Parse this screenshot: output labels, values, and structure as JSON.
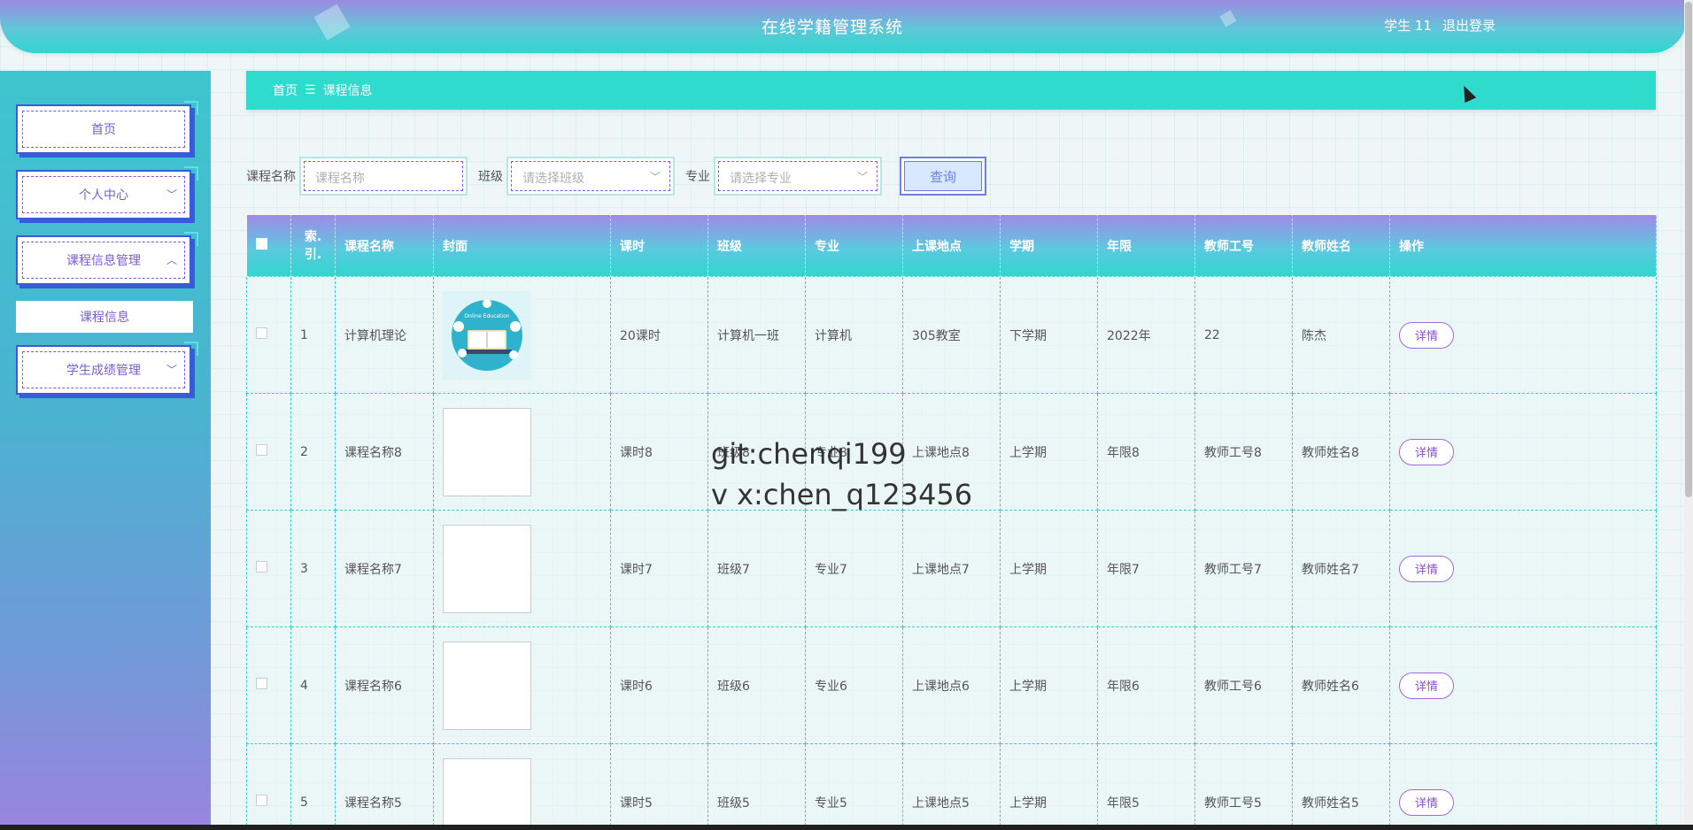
{
  "app": {
    "title": "在线学籍管理系统"
  },
  "user": {
    "name": "学生 11",
    "logout_label": "退出登录"
  },
  "sidebar": {
    "items": [
      {
        "label": "首页"
      },
      {
        "label": "个人中心"
      },
      {
        "label": "课程信息管理"
      },
      {
        "label": "学生成绩管理"
      }
    ],
    "sub_item": {
      "label": "课程信息"
    }
  },
  "breadcrumb": {
    "home": "首页",
    "separator": "☰",
    "current": "课程信息"
  },
  "search": {
    "course_label": "课程名称",
    "course_placeholder": "课程名称",
    "class_label": "班级",
    "class_placeholder": "请选择班级",
    "major_label": "专业",
    "major_placeholder": "请选择专业",
    "query_label": "查询"
  },
  "table": {
    "headers": [
      "索引",
      "课程名称",
      "封面",
      "课时",
      "班级",
      "专业",
      "上课地点",
      "学期",
      "年限",
      "教师工号",
      "教师姓名",
      "操作"
    ],
    "index_header_line1": "索.",
    "index_header_line2": "引.",
    "rows": [
      {
        "index": "1",
        "course": "计算机理论",
        "hours": "20课时",
        "class": "计算机一班",
        "major": "计算机",
        "location": "305教室",
        "term": "下学期",
        "year": "2022年",
        "teacher_id": "22",
        "teacher_name": "陈杰",
        "action": "详情",
        "cover_label": "Online Education"
      },
      {
        "index": "2",
        "course": "课程名称8",
        "hours": "课时8",
        "class": "班级8",
        "major": "专业8",
        "location": "上课地点8",
        "term": "上学期",
        "year": "年限8",
        "teacher_id": "教师工号8",
        "teacher_name": "教师姓名8",
        "action": "详情"
      },
      {
        "index": "3",
        "course": "课程名称7",
        "hours": "课时7",
        "class": "班级7",
        "major": "专业7",
        "location": "上课地点7",
        "term": "上学期",
        "year": "年限7",
        "teacher_id": "教师工号7",
        "teacher_name": "教师姓名7",
        "action": "详情"
      },
      {
        "index": "4",
        "course": "课程名称6",
        "hours": "课时6",
        "class": "班级6",
        "major": "专业6",
        "location": "上课地点6",
        "term": "上学期",
        "year": "年限6",
        "teacher_id": "教师工号6",
        "teacher_name": "教师姓名6",
        "action": "详情"
      },
      {
        "index": "5",
        "course": "课程名称5",
        "hours": "课时5",
        "class": "班级5",
        "major": "专业5",
        "location": "上课地点5",
        "term": "上学期",
        "year": "年限5",
        "teacher_id": "教师工号5",
        "teacher_name": "教师姓名5",
        "action": "详情"
      }
    ]
  },
  "watermark": {
    "line1": "git:chenqi199",
    "line2": "v x:chen_q123456"
  },
  "colors": {
    "accent": "#2edbcd",
    "purple": "#7a5cd6",
    "header_top": "#9b8be0"
  }
}
